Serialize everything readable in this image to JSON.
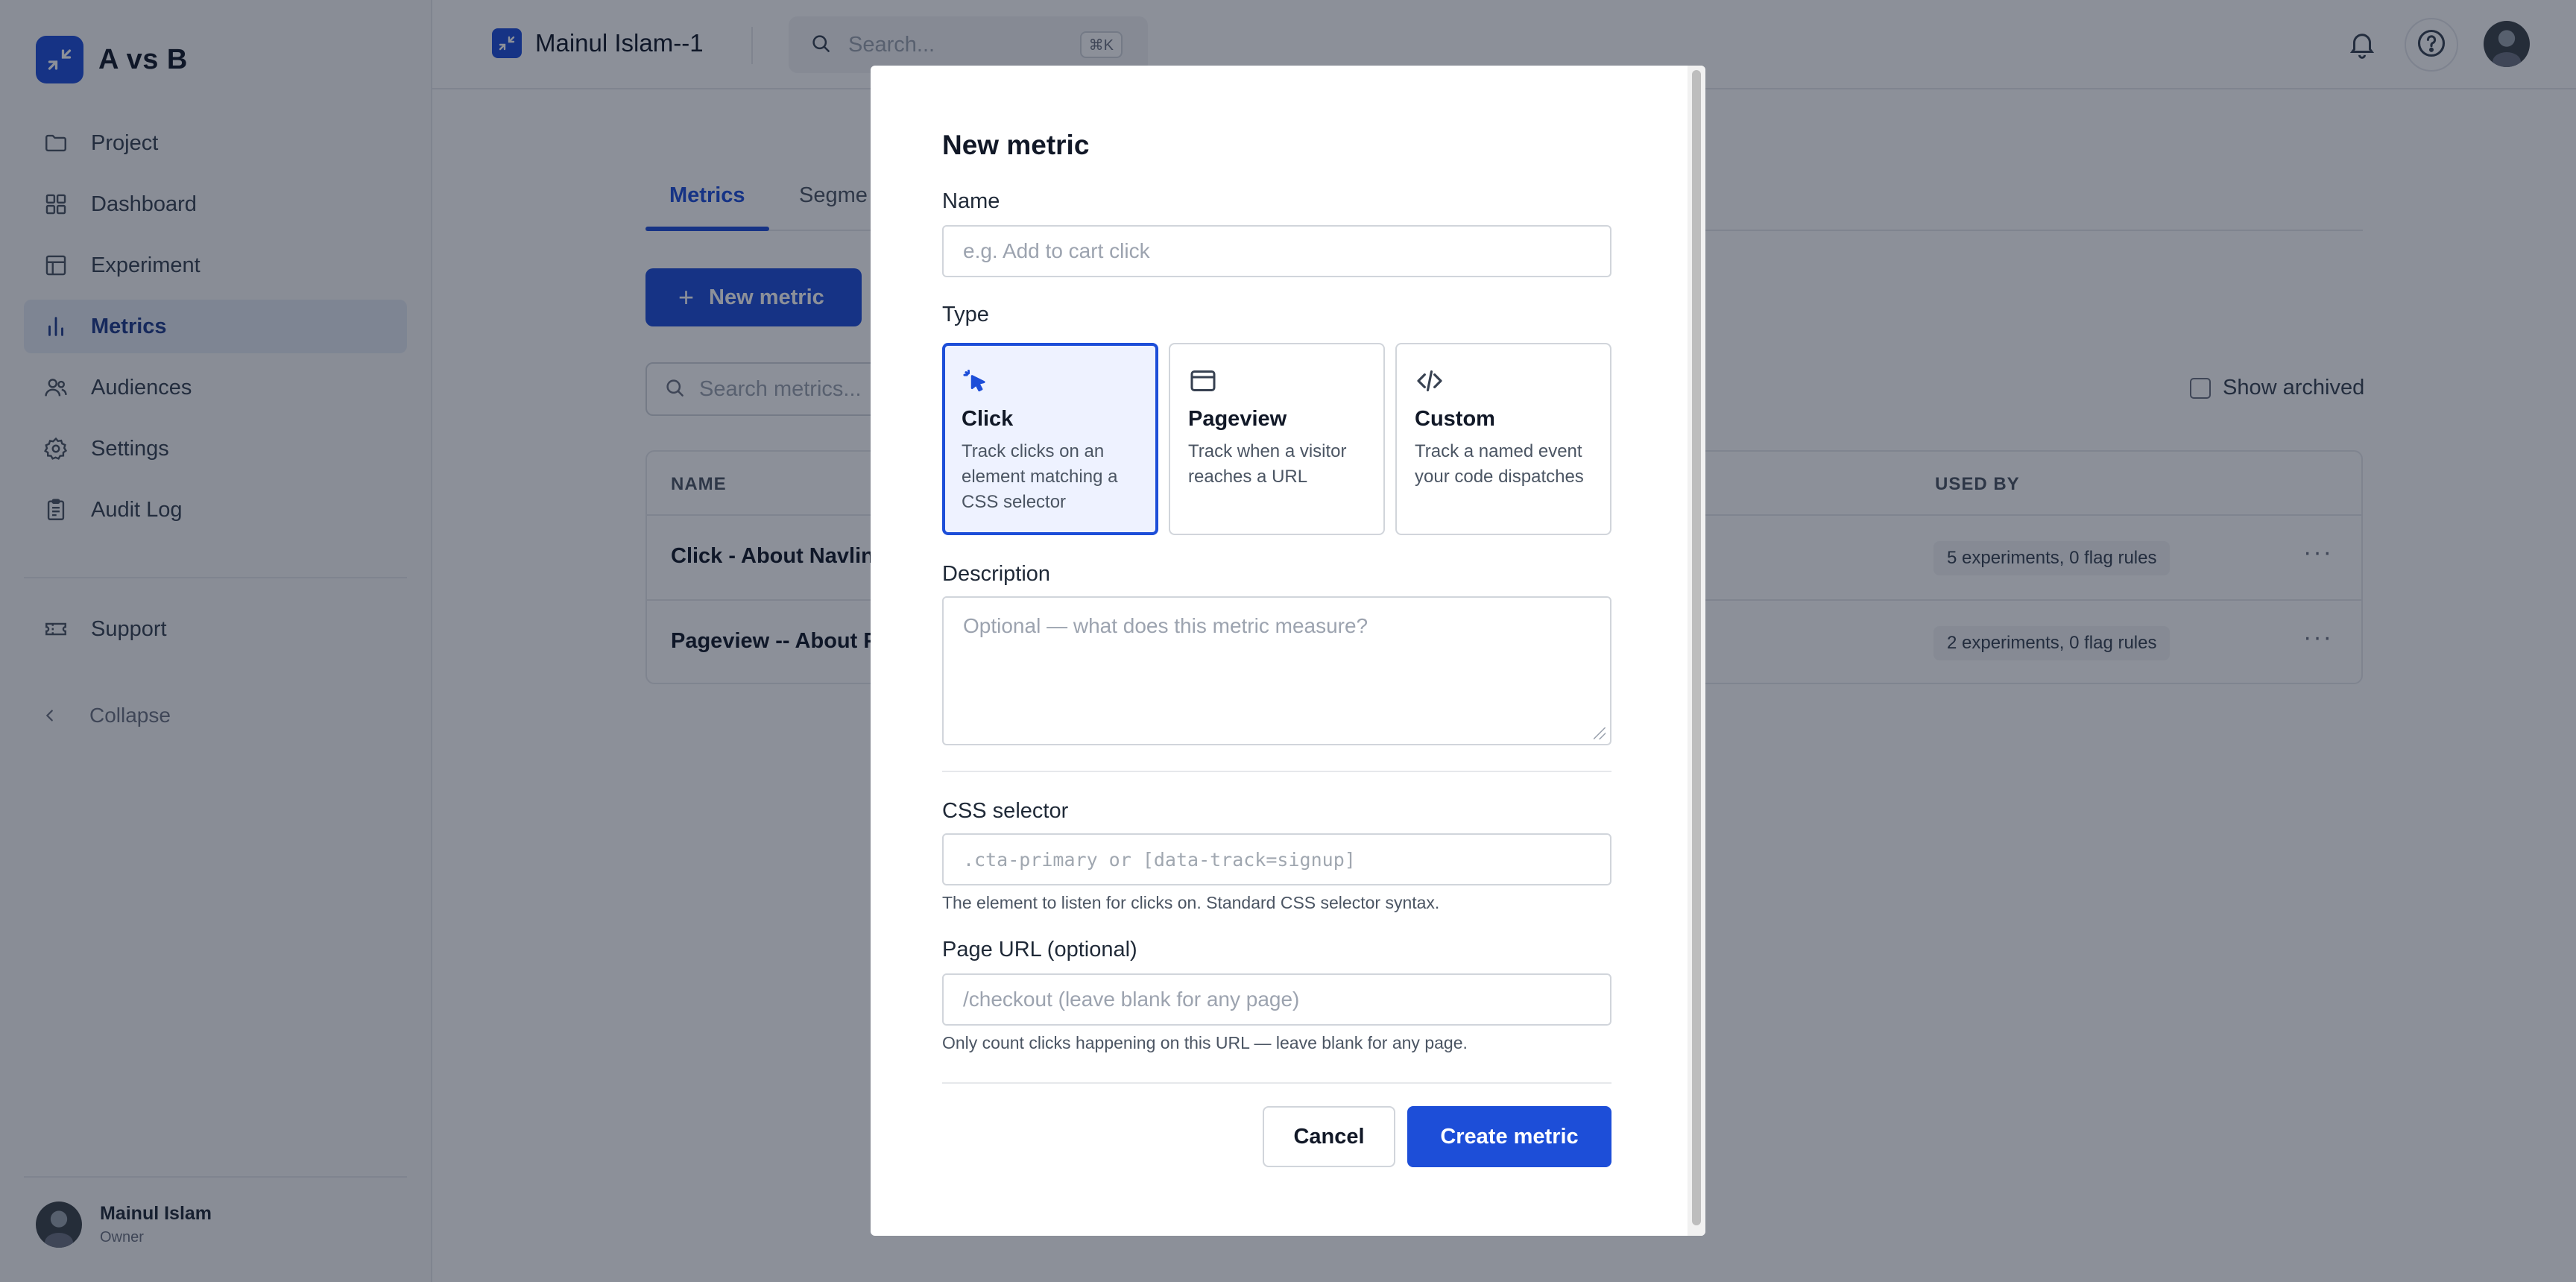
{
  "app": {
    "name": "A vs B",
    "accent": "#1d4ed8"
  },
  "sidebar": {
    "items": [
      {
        "label": "Project",
        "icon": "folder-icon"
      },
      {
        "label": "Dashboard",
        "icon": "grid-icon"
      },
      {
        "label": "Experiment",
        "icon": "table-icon"
      },
      {
        "label": "Metrics",
        "icon": "bar-chart-icon",
        "active": true
      },
      {
        "label": "Audiences",
        "icon": "users-icon"
      },
      {
        "label": "Settings",
        "icon": "gear-icon"
      },
      {
        "label": "Audit Log",
        "icon": "clipboard-icon"
      }
    ],
    "support_label": "Support",
    "collapse_label": "Collapse",
    "user": {
      "name": "Mainul Islam",
      "role": "Owner"
    }
  },
  "topbar": {
    "project_name": "Mainul Islam--1",
    "search_placeholder": "Search...",
    "search_shortcut": "⌘K"
  },
  "main": {
    "tabs": [
      {
        "label": "Metrics",
        "active": true
      },
      {
        "label": "Segme"
      }
    ],
    "new_metric_label": "New metric",
    "search_placeholder": "Search metrics...",
    "show_archived_label": "Show archived",
    "table": {
      "headers": {
        "name": "NAME",
        "used_by": "USED BY"
      },
      "rows": [
        {
          "name": "Click - About Navlin",
          "used_by": "5 experiments, 0 flag rules"
        },
        {
          "name": "Pageview -- About P",
          "used_by": "2 experiments, 0 flag rules"
        }
      ]
    }
  },
  "modal": {
    "title": "New metric",
    "name_label": "Name",
    "name_placeholder": "e.g. Add to cart click",
    "type_label": "Type",
    "types": [
      {
        "name": "Click",
        "description": "Track clicks on an element matching a CSS selector",
        "icon": "cursor-click-icon",
        "selected": true
      },
      {
        "name": "Pageview",
        "description": "Track when a visitor reaches a URL",
        "icon": "browser-window-icon",
        "selected": false
      },
      {
        "name": "Custom",
        "description": "Track a named event your code dispatches",
        "icon": "code-icon",
        "selected": false
      }
    ],
    "description_label": "Description",
    "description_placeholder": "Optional — what does this metric measure?",
    "css_selector_label": "CSS selector",
    "css_selector_placeholder": ".cta-primary or [data-track=signup]",
    "css_selector_help": "The element to listen for clicks on. Standard CSS selector syntax.",
    "page_url_label": "Page URL (optional)",
    "page_url_placeholder": "/checkout (leave blank for any page)",
    "page_url_help": "Only count clicks happening on this URL — leave blank for any page.",
    "cancel_label": "Cancel",
    "create_label": "Create metric"
  }
}
